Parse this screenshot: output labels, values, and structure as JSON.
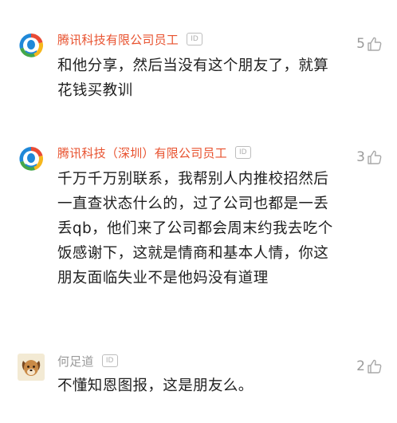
{
  "comments": [
    {
      "author": "腾讯科技有限公司员工",
      "badge": "ID",
      "avatar_icon": "tencent-logo-icon",
      "text": "和他分享，然后当没有这个朋友了，就算花钱买教训",
      "likes": "5"
    },
    {
      "author": "腾讯科技（深圳）有限公司员工",
      "badge": "ID",
      "avatar_icon": "tencent-logo-icon",
      "text": "千万千万别联系，我帮别人内推校招然后一直查状态什么的，过了公司也都是一丢丢qb，他们来了公司都会周末约我去吃个饭感谢下，这就是情商和基本人情，你这朋友面临失业不是他妈没有道理",
      "likes": "3"
    },
    {
      "author": "何足道",
      "badge": "ID",
      "avatar_icon": "dog-avatar-icon",
      "text": "不懂知恩图报，这是朋友么。",
      "likes": "2"
    }
  ],
  "colors": {
    "company_name": "#e8522f",
    "plain_name": "#9a9a9a",
    "body": "#1f1f1f",
    "muted": "#9a9a9a"
  },
  "icons": {
    "like": "thumbs-up-icon",
    "badge": "id-badge"
  }
}
